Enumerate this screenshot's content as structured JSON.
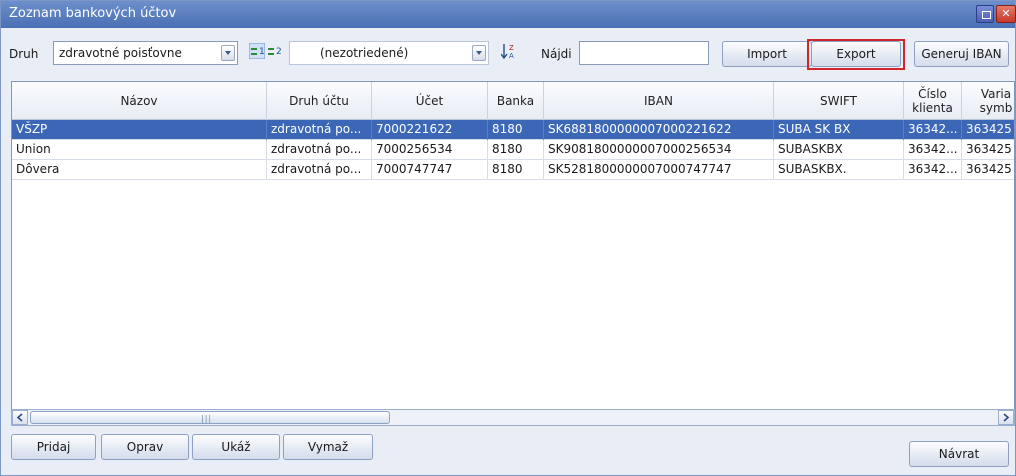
{
  "window": {
    "title": "Zoznam bankových účtov",
    "close_glyph": "✕"
  },
  "toolbar": {
    "druh_label": "Druh",
    "druh_value": "zdravotné poisťovne",
    "view1_label": "1",
    "view2_label": "2",
    "sort_value": "(nezotriedené)",
    "najdi_label": "Nájdi",
    "search_value": "",
    "import_label": "Import",
    "export_label": "Export",
    "generuj_label": "Generuj IBAN"
  },
  "table": {
    "headers": [
      "Názov",
      "Druh účtu",
      "Účet",
      "Banka",
      "IBAN",
      "SWIFT",
      "Číslo klienta",
      "Varia symb"
    ],
    "rows": [
      [
        "VŠZP",
        "zdravotná po...",
        "7000221622",
        "8180",
        "SK6881800000007000221622",
        "SUBA SK BX",
        "36342...",
        "363425"
      ],
      [
        "Union",
        "zdravotná po...",
        "7000256534",
        "8180",
        "SK9081800000007000256534",
        "SUBASKBX",
        "36342...",
        "363425"
      ],
      [
        "Dôvera",
        "zdravotná po...",
        "7000747747",
        "8180",
        "SK5281800000007000747747",
        "SUBASKBX.",
        "36342...",
        "363425"
      ]
    ],
    "selected_row": 0
  },
  "footer": {
    "pridaj_label": "Pridaj",
    "oprav_label": "Oprav",
    "ukaz_label": "Ukáž",
    "vymaz_label": "Vymaž",
    "navrat_label": "Návrat"
  },
  "colors": {
    "selection": "#3c67b6",
    "highlight": "#d0262b",
    "titlebar": "#4a6fb3"
  }
}
